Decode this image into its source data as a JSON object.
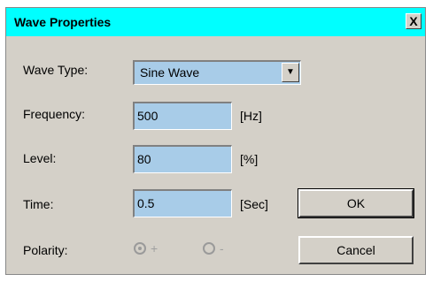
{
  "window": {
    "title": "Wave Properties",
    "close_glyph": "X"
  },
  "form": {
    "wave_type_label": "Wave Type:",
    "wave_type_value": "Sine Wave",
    "frequency_label": "Frequency:",
    "frequency_value": "500",
    "frequency_unit": "[Hz]",
    "level_label": "Level:",
    "level_value": "80",
    "level_unit": "[%]",
    "time_label": "Time:",
    "time_value": "0.5",
    "time_unit": "[Sec]",
    "polarity_label": "Polarity:",
    "polarity_options": [
      {
        "label": "+",
        "selected": true
      },
      {
        "label": "-",
        "selected": false
      }
    ]
  },
  "buttons": {
    "ok_label": "OK",
    "cancel_label": "Cancel"
  },
  "colors": {
    "titlebar": "#00ffff",
    "field_bg": "#a8cce8",
    "dialog_bg": "#d4d0c8"
  }
}
